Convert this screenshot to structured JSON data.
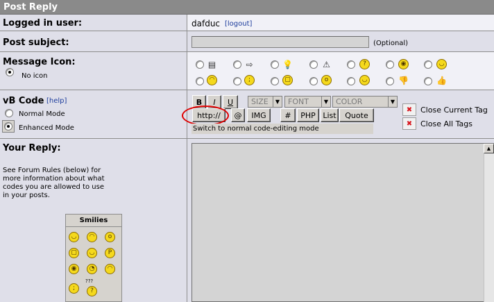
{
  "header": {
    "title": "Post Reply"
  },
  "logged": {
    "label": "Logged in user:",
    "user": "dafduc",
    "logout": "[logout]"
  },
  "subject": {
    "label": "Post subject:",
    "hint": "(Optional)"
  },
  "msgicon": {
    "label": "Message Icon:",
    "noicon": "No icon"
  },
  "vbcode": {
    "label": "vB Code",
    "help": "[help]",
    "normal": "Normal Mode",
    "enhanced": "Enhanced Mode",
    "bold": "B",
    "italic": "I",
    "underline": "U",
    "size": "SIZE",
    "font": "FONT",
    "color": "COLOR",
    "http": "http://",
    "email": "@",
    "img": "IMG",
    "code": "#",
    "php": "PHP",
    "list": "List",
    "quote": "Quote",
    "close_current": "Close Current Tag",
    "close_all": "Close All Tags",
    "status": "Switch to normal code-editing mode"
  },
  "reply": {
    "label": "Your Reply:",
    "help1": "See Forum Rules (below) for",
    "help2": "more information about what",
    "help3": "codes you are allowed to use",
    "help4": "in your posts."
  },
  "smilies": {
    "title": "Smilies",
    "more": "???"
  },
  "colors": {
    "header_bg": "#8a8a8a",
    "cell_bg": "#dfdfe9",
    "highlight": "#e00000"
  }
}
